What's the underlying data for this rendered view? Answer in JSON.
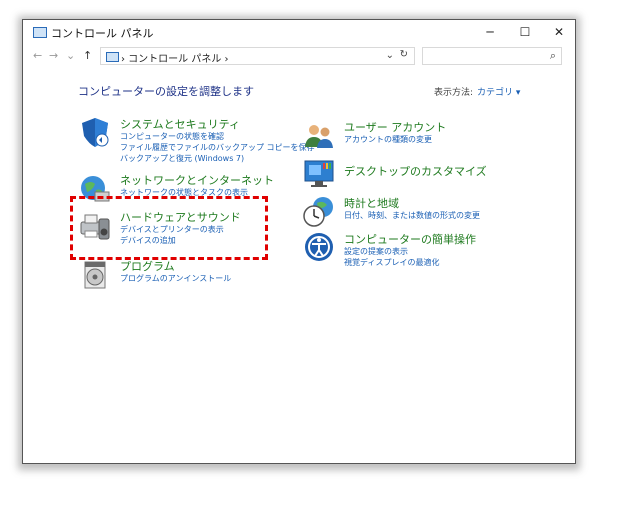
{
  "window": {
    "title": "コントロール パネル",
    "buttons": {
      "minimize": "─",
      "maximize": "☐",
      "close": "✕"
    }
  },
  "nav": {
    "back": "←",
    "forward": "→",
    "recent": "⌄",
    "up": "↑"
  },
  "address": {
    "path": "› コントロール パネル ›",
    "dropdown": "⌄",
    "refresh": "↻"
  },
  "search": {
    "placeholder": "",
    "icon": "search-icon",
    "glyph": "⌕"
  },
  "main": {
    "heading": "コンピューターの設定を調整します",
    "view_by_label": "表示方法:",
    "view_by_value": "カテゴリ ▾",
    "left": [
      {
        "title": "システムとセキュリティ",
        "icon": "shield-icon",
        "links": [
          "コンピューターの状態を確認",
          "ファイル履歴でファイルのバックアップ コピーを保存",
          "バックアップと復元 (Windows 7)"
        ]
      },
      {
        "title": "ネットワークとインターネット",
        "icon": "network-globe-icon",
        "links": [
          "ネットワークの状態とタスクの表示"
        ]
      },
      {
        "title": "ハードウェアとサウンド",
        "icon": "printer-speaker-icon",
        "links": [
          "デバイスとプリンターの表示",
          "デバイスの追加"
        ]
      },
      {
        "title": "プログラム",
        "icon": "program-disk-icon",
        "links": [
          "プログラムのアンインストール"
        ]
      }
    ],
    "right": [
      {
        "title": "ユーザー アカウント",
        "icon": "users-icon",
        "links": [
          "アカウントの種類の変更"
        ]
      },
      {
        "title": "デスクトップのカスタマイズ",
        "icon": "monitor-icon",
        "links": []
      },
      {
        "title": "時計と地域",
        "icon": "clock-globe-icon",
        "links": [
          "日付、時刻、または数値の形式の変更"
        ]
      },
      {
        "title": "コンピューターの簡単操作",
        "icon": "accessibility-icon",
        "links": [
          "設定の提案の表示",
          "視覚ディスプレイの最適化"
        ]
      }
    ]
  },
  "colors": {
    "accent": "#1a5fb4",
    "category": "#1e7a1e",
    "highlight": "#e00000"
  }
}
